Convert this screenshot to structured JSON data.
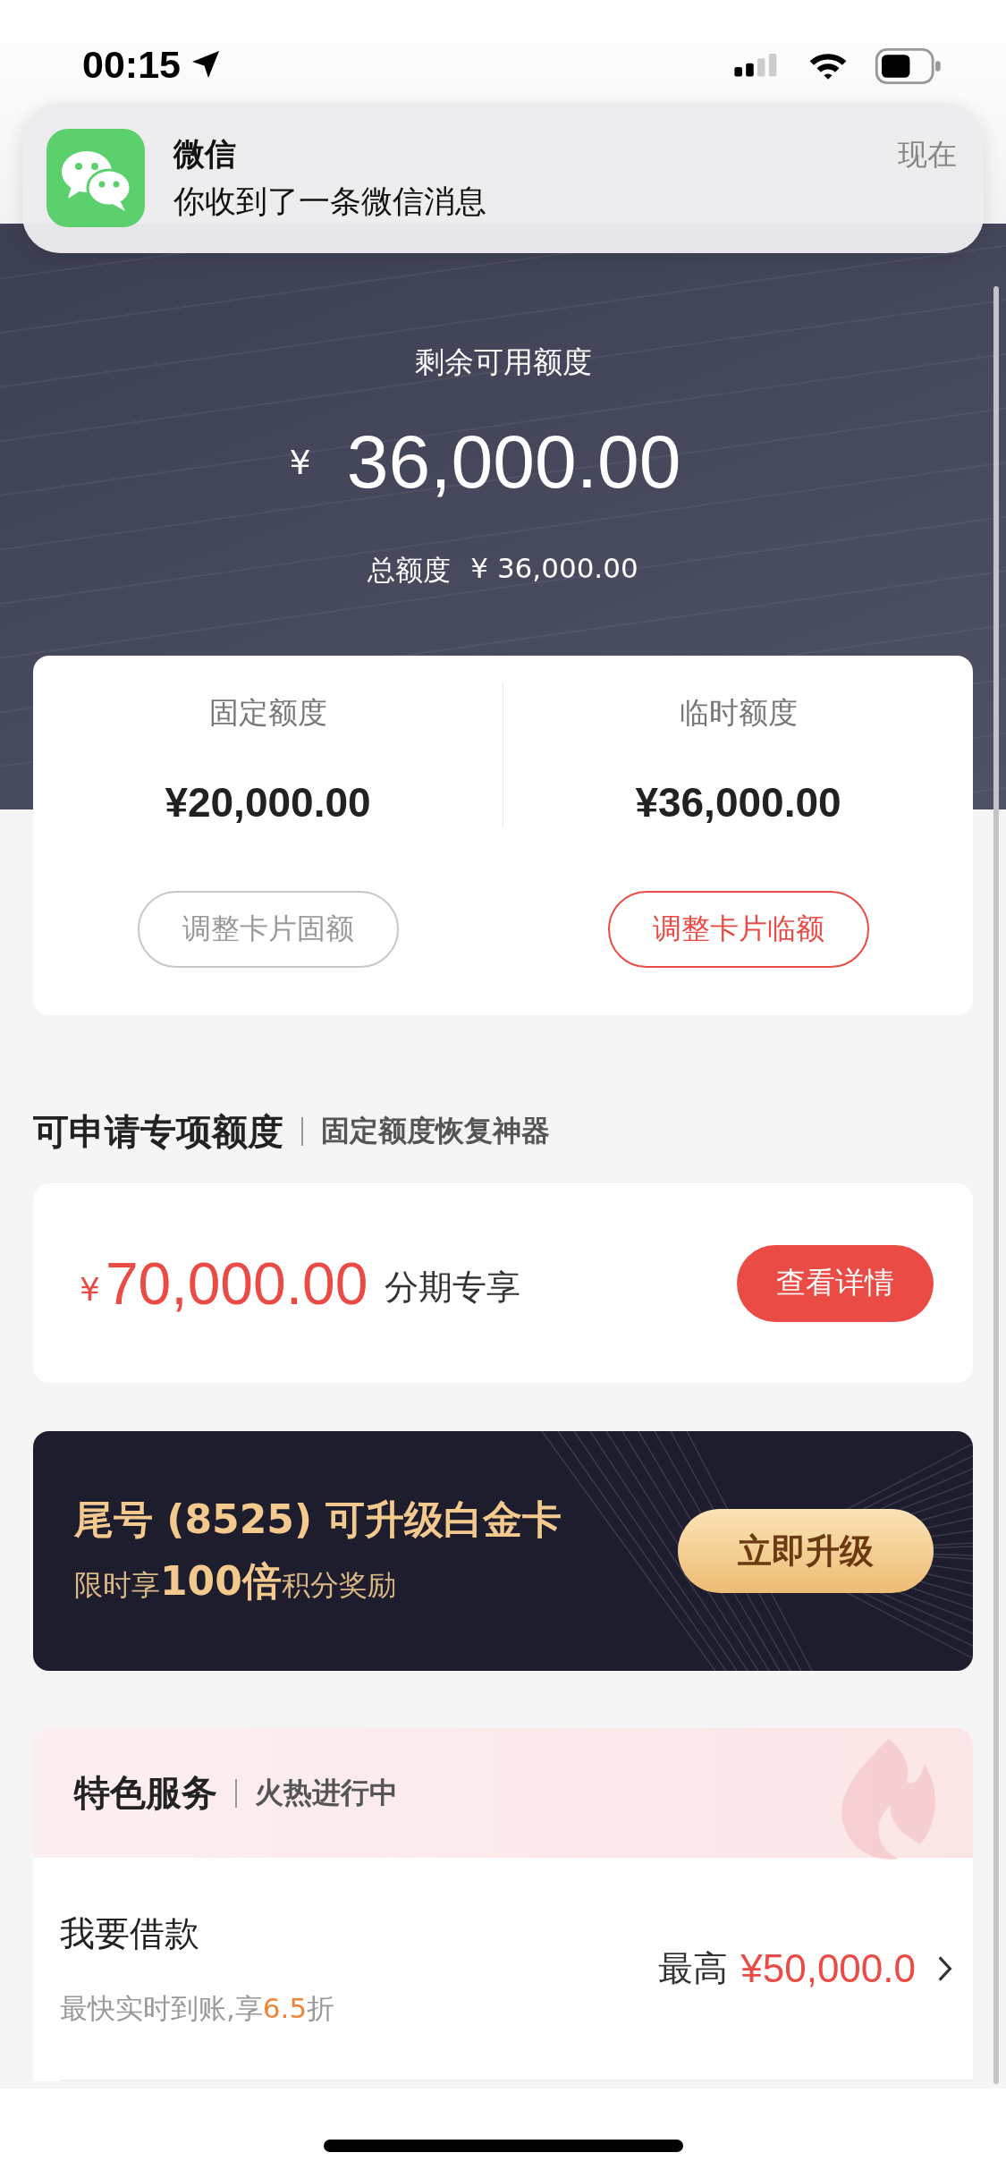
{
  "status_bar": {
    "time": "00:15"
  },
  "notification": {
    "app": "微信",
    "message": "你收到了一条微信消息",
    "time": "现在"
  },
  "balance": {
    "label": "剩余可用额度",
    "currency": "¥",
    "amount": "36,000.00",
    "total_label": "总额度",
    "total": "¥ 36,000.00"
  },
  "limits": [
    {
      "label": "固定额度",
      "amount": "¥20,000.00",
      "button": "调整卡片固额",
      "highlighted": false
    },
    {
      "label": "临时额度",
      "amount": "¥36,000.00",
      "button": "调整卡片临额",
      "highlighted": true
    }
  ],
  "special": {
    "title": "可申请专项额度",
    "subtitle": "固定额度恢复神器",
    "currency": "¥",
    "amount": "70,000.00",
    "note": "分期专享",
    "button": "查看详情"
  },
  "upgrade": {
    "title": "尾号 (8525) 可升级白金卡",
    "subtitle": "限时享**100倍**积分奖励",
    "button": "立即升级"
  },
  "services": {
    "title": "特色服务",
    "subtitle": "火热进行中",
    "items": [
      {
        "title": "我要借款",
        "desc": [
          {
            "text": "最快实时到账,享",
            "highlight": false
          },
          {
            "text": "6.5",
            "highlight": true
          },
          {
            "text": "折",
            "highlight": false
          }
        ],
        "prefix": "最高",
        "value": "¥50,000.0"
      }
    ]
  }
}
